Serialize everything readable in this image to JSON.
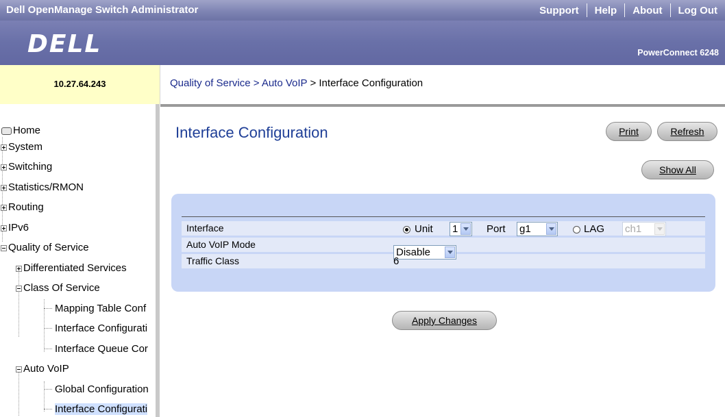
{
  "app": {
    "title": "Dell OpenManage Switch Administrator",
    "nav": [
      "Support",
      "Help",
      "About",
      "Log Out"
    ],
    "logo": "DELL",
    "model": "PowerConnect 6248"
  },
  "ip_address": "10.27.64.243",
  "breadcrumb": {
    "item1": "Quality of Service",
    "item2": "Auto VoIP",
    "current": "Interface Configuration",
    "separator": " > "
  },
  "sidebar": {
    "home": "Home",
    "system": "System",
    "switching": "Switching",
    "statistics": "Statistics/RMON",
    "routing": "Routing",
    "ipv6": "IPv6",
    "qos": "Quality of Service",
    "diffserv": "Differentiated Services",
    "cos": "Class Of Service",
    "cos_mapping": "Mapping Table Conf",
    "cos_iface": "Interface Configurati",
    "cos_queue": "Interface Queue Cor",
    "autovoip": "Auto VoIP",
    "voip_global": "Global Configuration",
    "voip_iface": "Interface Configurati"
  },
  "page": {
    "title": "Interface Configuration",
    "print": "Print",
    "refresh": "Refresh",
    "show_all": "Show All",
    "apply": "Apply Changes"
  },
  "form": {
    "interface_label": "Interface",
    "unit_label": "Unit",
    "unit_value": "1",
    "port_label": "Port",
    "port_value": "g1",
    "lag_label": "LAG",
    "lag_value": "ch1",
    "mode_label": "Auto VoIP Mode",
    "mode_value": "Disable",
    "traffic_label": "Traffic Class",
    "traffic_value": "6"
  },
  "colors": {
    "header_blue": "#6d73a6",
    "panel": "#c8d6f6",
    "row": "#e3e9f8",
    "title": "#1f3f97",
    "ip_bg": "#ffffc8"
  },
  "icons": {
    "home": "home-drive-icon",
    "expand": "plus-box-icon",
    "collapse": "minus-box-icon",
    "leaf": "tree-leaf-line"
  }
}
